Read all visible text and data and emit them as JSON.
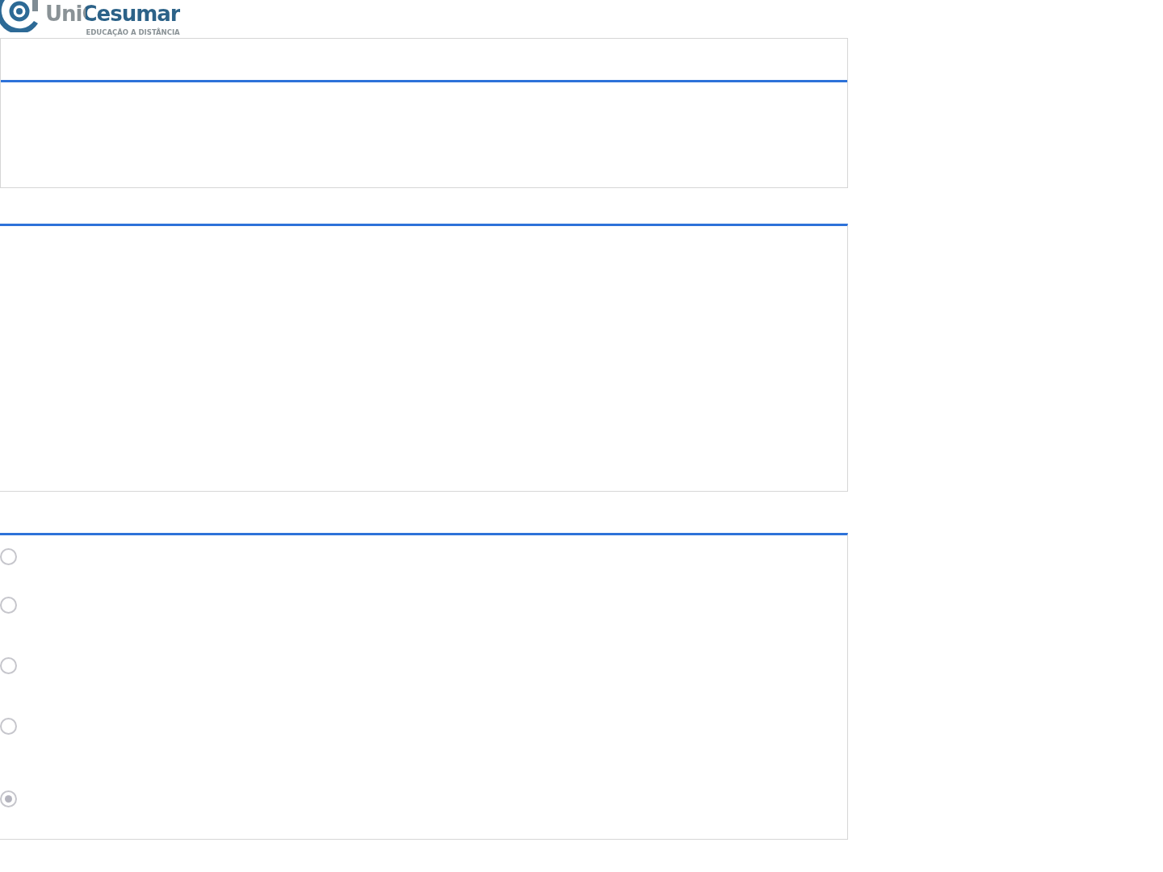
{
  "logo": {
    "name": "UniCesumar",
    "tagline": "EDUCAÇÃO A DISTÂNCIA"
  },
  "options": [
    {
      "selected": false
    },
    {
      "selected": false
    },
    {
      "selected": false
    },
    {
      "selected": false
    },
    {
      "selected": true
    }
  ]
}
